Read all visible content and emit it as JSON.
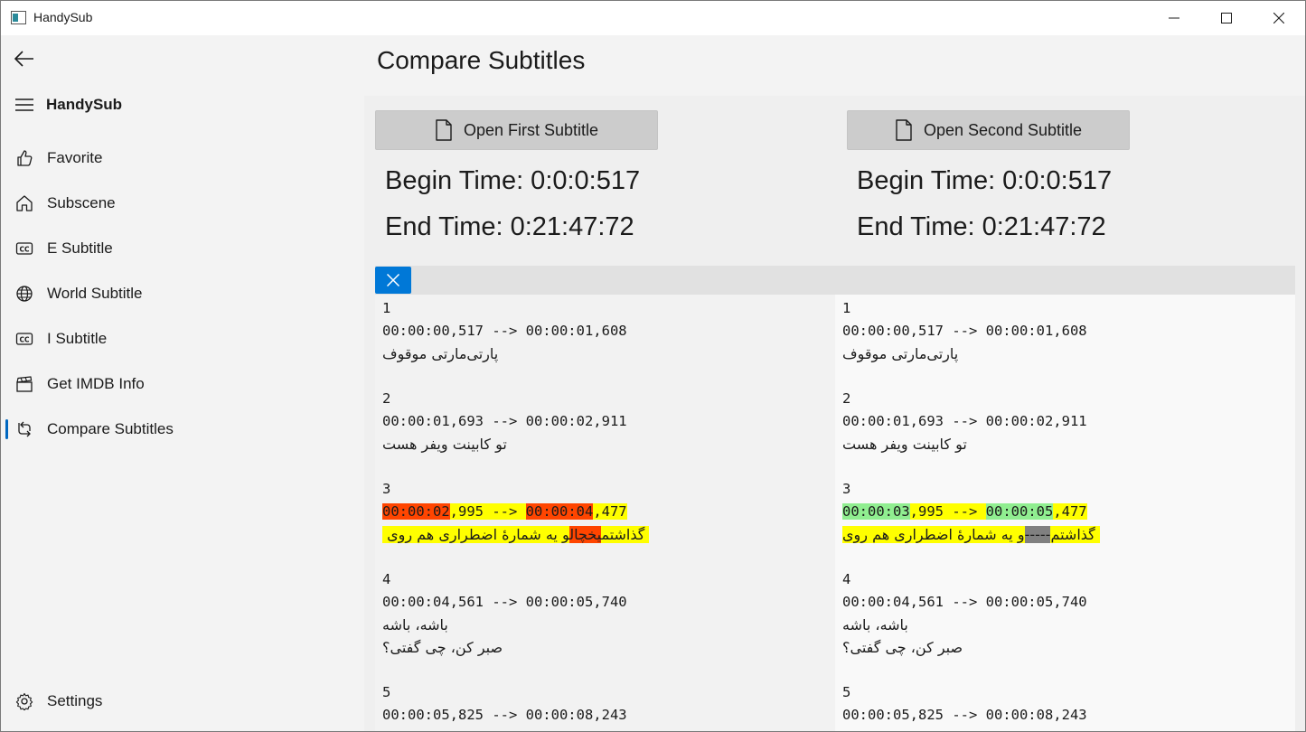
{
  "window": {
    "title": "HandySub"
  },
  "sidebar": {
    "brand": "HandySub",
    "items": [
      {
        "label": "Favorite",
        "icon": "thumb-up-icon"
      },
      {
        "label": "Subscene",
        "icon": "home-icon"
      },
      {
        "label": "E Subtitle",
        "icon": "closed-caption-icon"
      },
      {
        "label": "World Subtitle",
        "icon": "globe-icon"
      },
      {
        "label": "I Subtitle",
        "icon": "closed-caption-icon"
      },
      {
        "label": "Get IMDB Info",
        "icon": "clapperboard-icon"
      },
      {
        "label": "Compare Subtitles",
        "icon": "sync-icon",
        "active": true
      }
    ],
    "settings_label": "Settings"
  },
  "page": {
    "title": "Compare Subtitles"
  },
  "left": {
    "open_label": "Open First Subtitle",
    "begin": "Begin Time: 0:0:0:517",
    "end": "End Time: 0:21:47:72"
  },
  "right": {
    "open_label": "Open Second Subtitle",
    "begin": "Begin Time: 0:0:0:517",
    "end": "End Time: 0:21:47:72"
  },
  "subtitles_left": [
    {
      "index": "1",
      "time": "00:00:00,517 --> 00:00:01,608",
      "lines": [
        "پارتی‌مارتی موقوف"
      ]
    },
    {
      "index": "2",
      "time": "00:00:01,693 --> 00:00:02,911",
      "lines": [
        "تو کابینت ویفر هست"
      ]
    },
    {
      "index": "3",
      "time_parts": [
        "00:00:02",
        ",995 --> ",
        "00:00:04",
        ",477"
      ],
      "line_parts": [
        "و یه شمارهٔ اضطراری هم روی ",
        "یخچال",
        " گذاشتم"
      ]
    },
    {
      "index": "4",
      "time": "00:00:04,561 --> 00:00:05,740",
      "lines": [
        "باشه، باشه",
        "صبر کن، چی گفتی؟"
      ]
    },
    {
      "index": "5",
      "time": "00:00:05,825 --> 00:00:08,243",
      "lines": []
    }
  ],
  "subtitles_right": [
    {
      "index": "1",
      "time": "00:00:00,517 --> 00:00:01,608",
      "lines": [
        "پارتی‌مارتی موقوف"
      ]
    },
    {
      "index": "2",
      "time": "00:00:01,693 --> 00:00:02,911",
      "lines": [
        "تو کابینت ویفر هست"
      ]
    },
    {
      "index": "3",
      "time_parts": [
        "00:00:03",
        ",995 --> ",
        "00:00:05",
        ",477"
      ],
      "line_parts": [
        "و یه شمارهٔ اضطراری هم روی ",
        "-----",
        "گذاشتم"
      ]
    },
    {
      "index": "4",
      "time": "00:00:04,561 --> 00:00:05,740",
      "lines": [
        "باشه، باشه",
        "صبر کن، چی گفتی؟"
      ]
    },
    {
      "index": "5",
      "time": "00:00:05,825 --> 00:00:08,243",
      "lines": []
    }
  ],
  "colors": {
    "accent": "#0078d7",
    "diff_changed": "#ff4500",
    "diff_added": "#90ee90",
    "diff_line": "#ffff00",
    "diff_removed": "#808080"
  }
}
